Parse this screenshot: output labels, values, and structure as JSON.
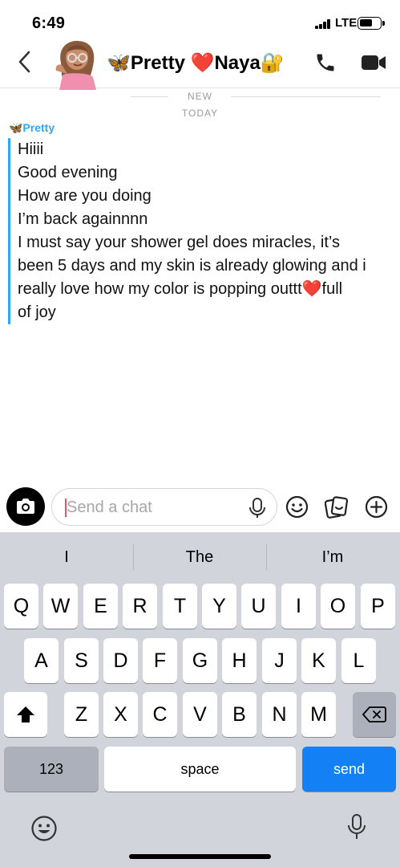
{
  "status_bar": {
    "time": "6:49",
    "network": "LTE"
  },
  "header": {
    "contact_name": "🦋Pretty ❤️Naya🔐"
  },
  "conversation": {
    "new_label": "NEW",
    "date_label": "TODAY",
    "sender": "🦋Pretty",
    "message_lines": [
      "Hiiii",
      "Good evening",
      "How are you doing",
      "I’m back againnnn",
      "I must say your shower gel does miracles, it’s",
      "been 5 days and my skin is already glowing and i",
      "really love how my color is popping outtt❤️full",
      "of joy"
    ]
  },
  "composer": {
    "placeholder": "Send a chat"
  },
  "keyboard": {
    "suggestions": [
      "I",
      "The",
      "I’m"
    ],
    "row1": [
      "Q",
      "W",
      "E",
      "R",
      "T",
      "Y",
      "U",
      "I",
      "O",
      "P"
    ],
    "row2": [
      "A",
      "S",
      "D",
      "F",
      "G",
      "H",
      "J",
      "K",
      "L"
    ],
    "row3": [
      "Z",
      "X",
      "C",
      "V",
      "B",
      "N",
      "M"
    ],
    "numbers_label": "123",
    "space_label": "space",
    "send_label": "send"
  },
  "colors": {
    "accent_blue": "#2ea8f5",
    "send_blue": "#1480f5",
    "keyboard_bg": "#d1d4db"
  }
}
